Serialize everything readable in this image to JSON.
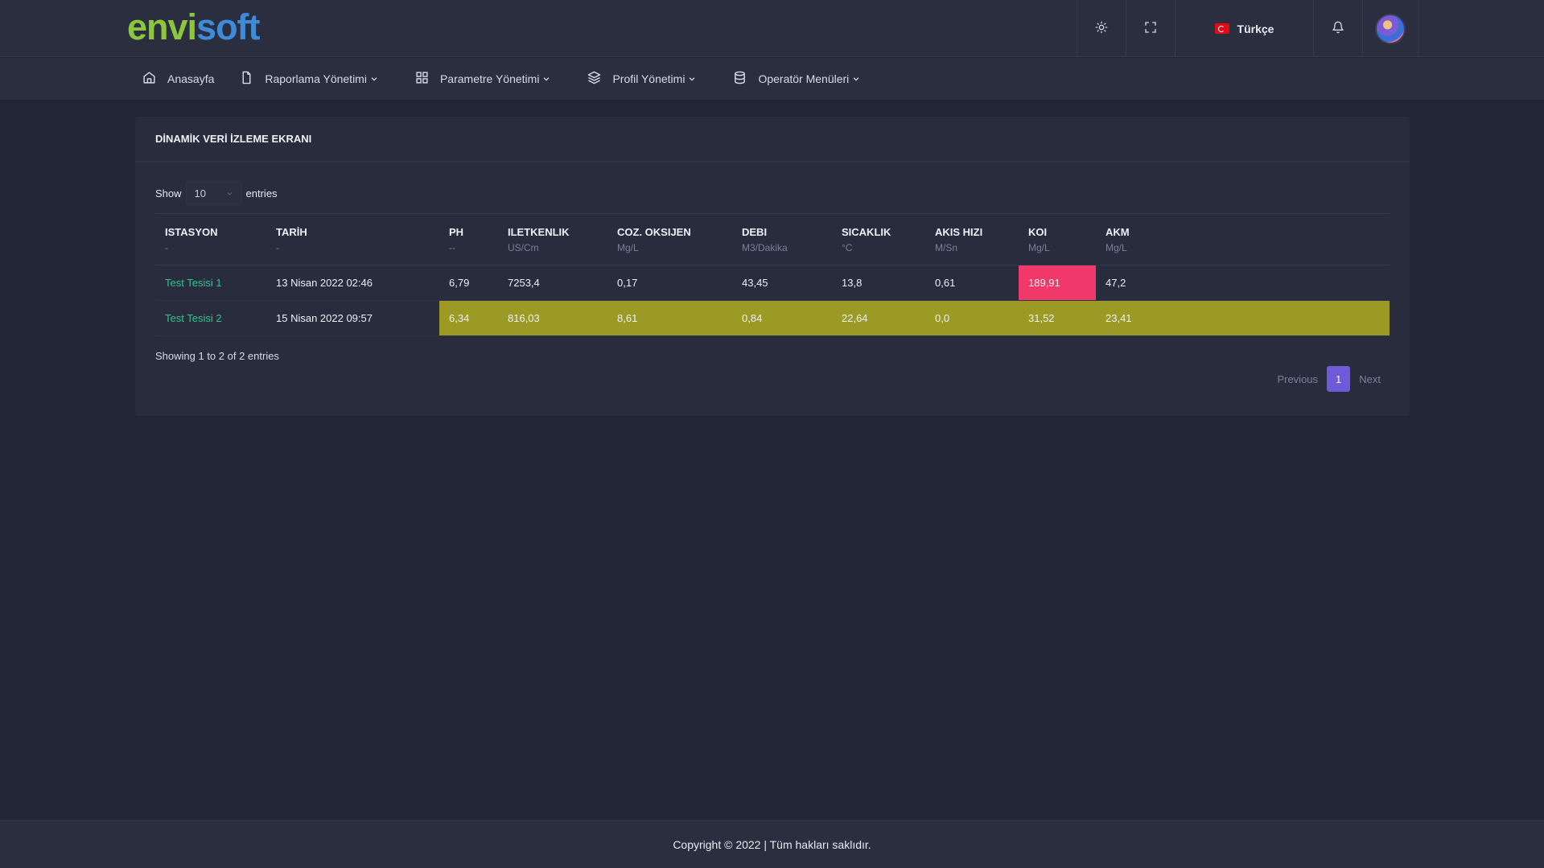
{
  "brand": {
    "name_part1": "envi",
    "name_part2": "soft"
  },
  "topbar": {
    "language": "Türkçe",
    "icons": [
      "sun-icon",
      "fullscreen-icon",
      "bell-icon"
    ]
  },
  "nav": {
    "items": [
      {
        "label": "Anasayfa",
        "icon": "home-icon",
        "dropdown": false
      },
      {
        "label": "Raporlama Yönetimi",
        "icon": "file-icon",
        "dropdown": true
      },
      {
        "label": "Parametre Yönetimi",
        "icon": "grid-icon",
        "dropdown": true
      },
      {
        "label": "Profil Yönetimi",
        "icon": "layers-icon",
        "dropdown": true
      },
      {
        "label": "Operatör Menüleri",
        "icon": "database-icon",
        "dropdown": true
      }
    ]
  },
  "card": {
    "title": "DİNAMİK VERİ İZLEME EKRANI",
    "length": {
      "show": "Show",
      "value": "10",
      "entries": "entries"
    },
    "columns": [
      {
        "name": "ISTASYON",
        "unit": "-"
      },
      {
        "name": "TARİH",
        "unit": "-"
      },
      {
        "name": "PH",
        "unit": "--"
      },
      {
        "name": "ILETKENLIK",
        "unit": "US/Cm"
      },
      {
        "name": "COZ. OKSIJEN",
        "unit": "Mg/L"
      },
      {
        "name": "DEBI",
        "unit": "M3/Dakika"
      },
      {
        "name": "SICAKLIK",
        "unit": "°C"
      },
      {
        "name": "AKIS HIZI",
        "unit": "M/Sn"
      },
      {
        "name": "KOI",
        "unit": "Mg/L"
      },
      {
        "name": "AKM",
        "unit": "Mg/L"
      }
    ],
    "rows": [
      [
        "Test Tesisi 1",
        "13 Nisan 2022 02:46",
        "6,79",
        "7253,4",
        "0,17",
        "43,45",
        "13,8",
        "0,61",
        "189,91",
        "47,2"
      ],
      [
        "Test Tesisi 2",
        "15 Nisan 2022 09:57",
        "6,34",
        "816,03",
        "8,61",
        "0,84",
        "22,64",
        "0,0",
        "31,52",
        "23,41"
      ]
    ],
    "highlight_colors": {
      "alarm": "#f0386b",
      "warning": "#9a9a24"
    },
    "info": "Showing 1 to 2 of 2 entries",
    "pagination": {
      "previous": "Previous",
      "current": "1",
      "next": "Next"
    }
  },
  "footer": {
    "text": "Copyright © 2022 | Tüm hakları saklıdır."
  }
}
